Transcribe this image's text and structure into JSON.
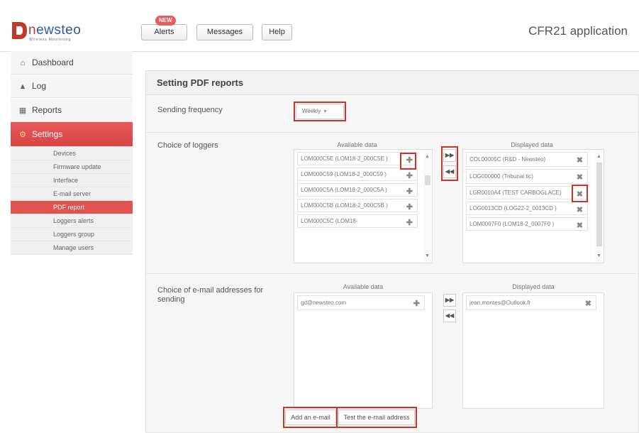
{
  "header": {
    "logo_text_first": "n",
    "logo_text_rest": "ewsteo",
    "logo_tagline": "Wireless Monitoring",
    "alerts_label": "Alerts",
    "alerts_badge": "NEW",
    "messages_label": "Messages",
    "help_label": "Help",
    "app_title": "CFR21 application"
  },
  "sidebar": {
    "items": [
      {
        "label": "Dashboard",
        "icon": "home-icon"
      },
      {
        "label": "Log",
        "icon": "user-icon"
      },
      {
        "label": "Reports",
        "icon": "building-icon"
      },
      {
        "label": "Settings",
        "icon": "wrench-icon"
      }
    ],
    "sub_items": [
      "Devices",
      "Firmware update",
      "Interface",
      "E-mail server",
      "PDF report",
      "Loggers alerts",
      "Loggers group",
      "Manage users"
    ],
    "active_sub_item": "PDF report"
  },
  "panel": {
    "title": "Setting PDF reports",
    "sending_frequency_label": "Sending frequency",
    "sending_frequency_value": "Weekly",
    "loggers_label": "Choice of loggers",
    "available_title": "Available data",
    "displayed_title": "Displayed data",
    "available_loggers": [
      "LOM000C5E (LOM18-2_000C5E )",
      "LOM000C59 (LOM18-2_000C59 )",
      "LOM000C5A (LOM18-2_000C5A )",
      "LOM000C5B (LOM18-2_000C5B )",
      "LOM000C5C (LOM18-"
    ],
    "displayed_loggers": [
      "COL00005C (R&D - Newsteo)",
      "LOG000000 (Tribunal tic)",
      "LGR0010A4 (TEST CARBOGLACE)",
      "LOG0013CD (LOG22-2_0013CD )",
      "LOM0007F0 (LOM18-2_0007F0 )"
    ],
    "emails_label": "Choice of e-mail addresses for sending",
    "available_emails": [
      "gd@newsteo.com"
    ],
    "displayed_emails": [
      "jean.montes@Outlook.fr"
    ],
    "add_email_label": "Add an e-mail",
    "test_email_label": "Test the e-mail address"
  },
  "colors": {
    "accent": "#d94343",
    "highlight": "#c0392b",
    "brand_blue": "#2b5aa8"
  }
}
